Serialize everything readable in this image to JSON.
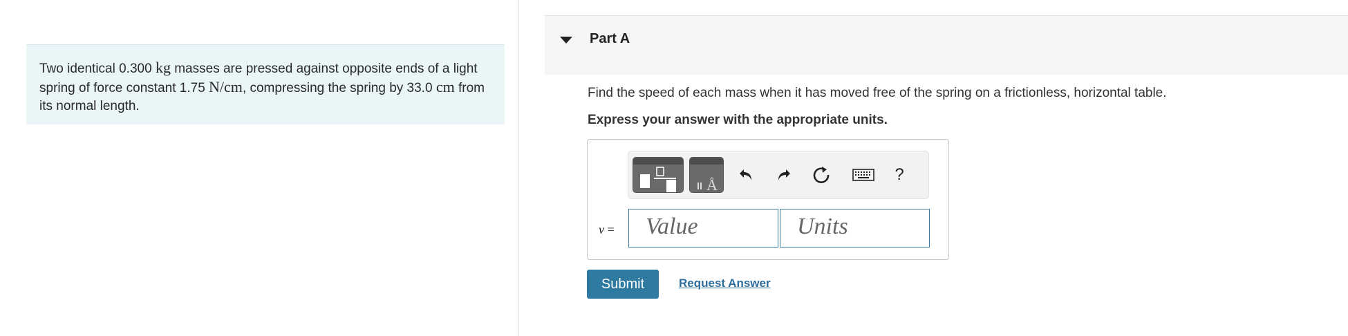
{
  "problem": {
    "part1": "Two identical 0.300 ",
    "unit_kg": "kg",
    "part2": " masses are pressed against opposite ends of a light spring of force constant 1.75 ",
    "unit_ncm": "N/cm",
    "part3": ", compressing the spring by 33.0 ",
    "unit_cm": "cm",
    "part4": " from its normal length."
  },
  "part": {
    "title": "Part A",
    "question": "Find the speed of each mass when it has moved free of the spring on a frictionless, horizontal table.",
    "instruction": "Express your answer with the appropriate units."
  },
  "answer": {
    "variable": "v",
    "equals": " =",
    "value_placeholder": "Value",
    "units_placeholder": "Units",
    "units_symbol": "Å",
    "help": "?"
  },
  "actions": {
    "submit": "Submit",
    "request_answer": "Request Answer"
  },
  "colors": {
    "problem_bg": "#e9f5f7",
    "submit_bg": "#2f7aa0",
    "link": "#2f6e9c",
    "field_border": "#3d7ea6"
  }
}
